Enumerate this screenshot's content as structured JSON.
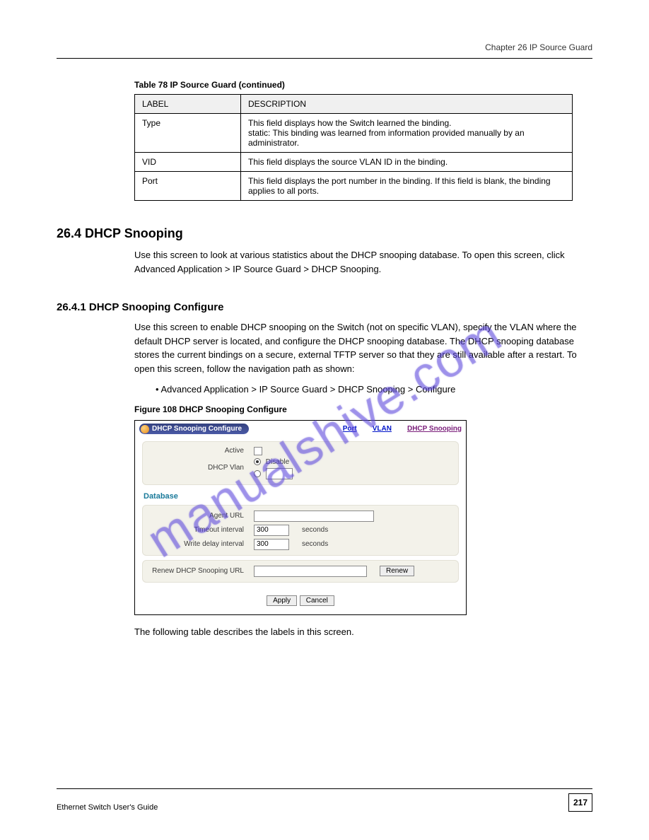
{
  "chapter": "Chapter 26 IP Source Guard",
  "table": {
    "caption": "Table 78   IP Source Guard (continued)",
    "headers": [
      "LABEL",
      "DESCRIPTION"
    ],
    "rows": [
      {
        "label": "Type",
        "desc": "This field displays how the Switch learned the binding.\nstatic: This binding was learned from information provided manually by an administrator."
      },
      {
        "label": "VID",
        "desc": "This field displays the source VLAN ID in the binding."
      },
      {
        "label": "Port",
        "desc": "This field displays the port number in the binding. If this field is blank, the binding applies to all ports."
      }
    ]
  },
  "section": {
    "num": "26.4  DHCP Snooping",
    "intro": "Use this screen to look at various statistics about the DHCP snooping database. To open this screen, click Advanced Application > IP Source Guard > DHCP Snooping."
  },
  "subsection": {
    "num": "26.4.1  DHCP Snooping Configure",
    "intro": "Use this screen to enable DHCP snooping on the Switch (not on specific VLAN), specify the VLAN where the default DHCP server is located, and configure the DHCP snooping database. The DHCP snooping database stores the current bindings on a secure, external TFTP server so that they are still available after a restart. To open this screen, follow the navigation path as shown:",
    "steps_label": "• Advanced Application > IP Source Guard > DHCP Snooping > Configure"
  },
  "figure": {
    "caption": "Figure 108   DHCP Snooping Configure",
    "title_bar": "DHCP Snooping Configure",
    "links": {
      "port": "Port",
      "vlan": "VLAN",
      "dhcp": "DHCP Snooping"
    },
    "rows": {
      "active_label": "Active",
      "dhcp_vlan_label": "DHCP Vlan",
      "disable_label": "Disable",
      "db_heading": "Database",
      "agent_url_label": "Agent URL",
      "timeout_label": "Timeout interval",
      "timeout_value": "300",
      "write_delay_label": "Write delay interval",
      "write_delay_value": "300",
      "seconds": "seconds",
      "renew_label": "Renew DHCP Snooping URL",
      "renew_btn": "Renew",
      "apply_btn": "Apply",
      "cancel_btn": "Cancel"
    }
  },
  "post_text": "The following table describes the labels in this screen.",
  "footer": {
    "guide": "Ethernet Switch User's Guide",
    "page": "217"
  },
  "watermark": "manualshive.com"
}
